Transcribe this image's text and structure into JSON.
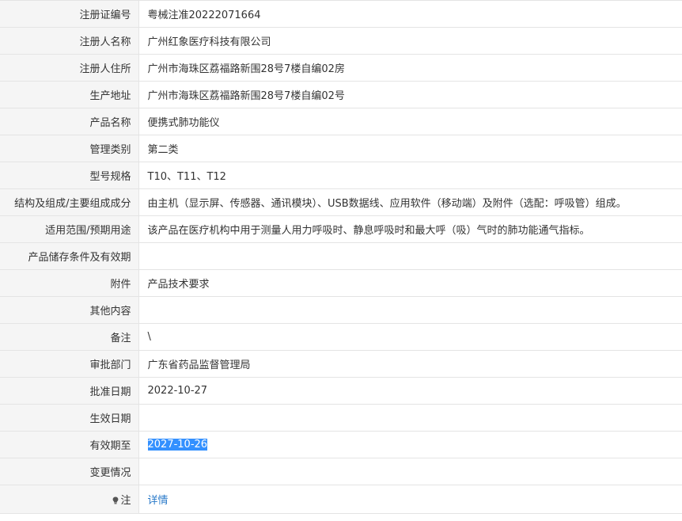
{
  "rows": [
    {
      "label": "注册证编号",
      "value": "粤械注准20222071664"
    },
    {
      "label": "注册人名称",
      "value": "广州红象医疗科技有限公司"
    },
    {
      "label": "注册人住所",
      "value": "广州市海珠区荔福路新围28号7楼自编02房"
    },
    {
      "label": "生产地址",
      "value": "广州市海珠区荔福路新围28号7楼自编02号"
    },
    {
      "label": "产品名称",
      "value": "便携式肺功能仪"
    },
    {
      "label": "管理类别",
      "value": "第二类"
    },
    {
      "label": "型号规格",
      "value": "T10、T11、T12"
    },
    {
      "label": "结构及组成/主要组成成分",
      "value": "由主机（显示屏、传感器、通讯模块）、USB数据线、应用软件（移动端）及附件（选配：呼吸管）组成。"
    },
    {
      "label": "适用范围/预期用途",
      "value": "该产品在医疗机构中用于测量人用力呼吸时、静息呼吸时和最大呼（吸）气时的肺功能通气指标。"
    },
    {
      "label": "产品储存条件及有效期",
      "value": ""
    },
    {
      "label": "附件",
      "value": "产品技术要求"
    },
    {
      "label": "其他内容",
      "value": ""
    },
    {
      "label": "备注",
      "value": "\\"
    },
    {
      "label": "审批部门",
      "value": "广东省药品监督管理局"
    },
    {
      "label": "批准日期",
      "value": "2022-10-27"
    },
    {
      "label": "生效日期",
      "value": ""
    },
    {
      "label": "有效期至",
      "value": "2027-10-26"
    },
    {
      "label": "变更情况",
      "value": ""
    },
    {
      "label": "注",
      "value": "详情"
    }
  ],
  "colors": {
    "label_background": "#f5f5f5",
    "border": "#e4e4e4",
    "selection": "#3390ff",
    "link": "#2a7ac9"
  },
  "icons": {
    "note_icon": "lightbulb-icon"
  }
}
